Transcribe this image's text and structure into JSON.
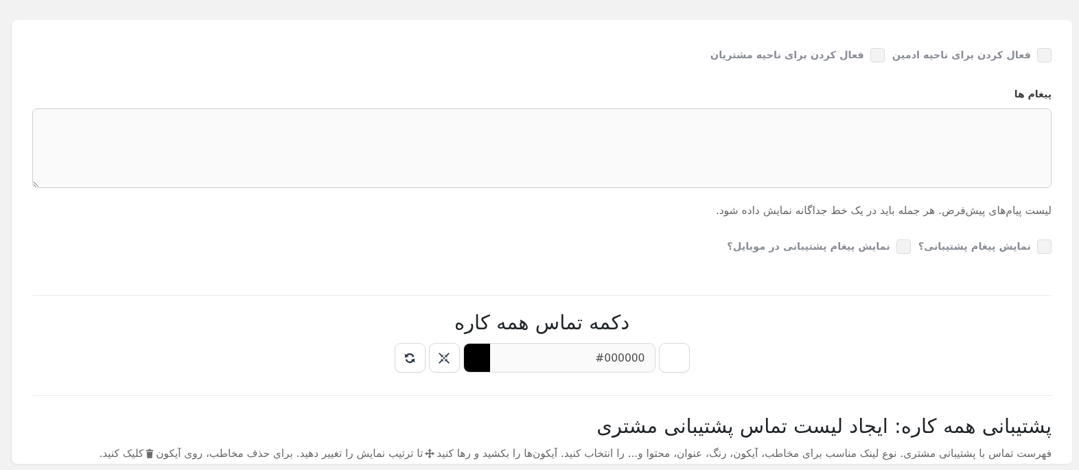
{
  "admin_options": [
    {
      "label": "فعال کردن برای ناحیه ادمین",
      "checked": false
    },
    {
      "label": "فعال کردن برای ناحیه مشتریان",
      "checked": false
    }
  ],
  "messages": {
    "label": "پیغام ها",
    "help": "لیست پیام‌های پیش‌فرض. هر جمله باید در یک خط جداگانه نمایش داده شود."
  },
  "display_options": [
    {
      "label": "نمایش پیغام پشتیبانی؟",
      "checked": false
    },
    {
      "label": "نمایش پیغام پشتیبانی در موبایل؟",
      "checked": false
    }
  ],
  "contact_button": {
    "title": "دکمه تماس همه کاره",
    "color_value": "#000000"
  },
  "support_list": {
    "title": "پشتیبانی همه کاره: ایجاد لیست تماس پشتیبانی مشتری",
    "description": [
      "فهرست تماس با پشتیبانی مشتری. نوع لینک مناسب برای مخاطب، آیکون، رنگ، عنوان، محتوا و... را انتخاب کنید. آیکون‌ها را بکشید و رها کنید",
      "تا ترتیب نمایش را تغییر دهید. برای حذف مخاطب، روی آیکون",
      "کلیک کنید."
    ]
  }
}
